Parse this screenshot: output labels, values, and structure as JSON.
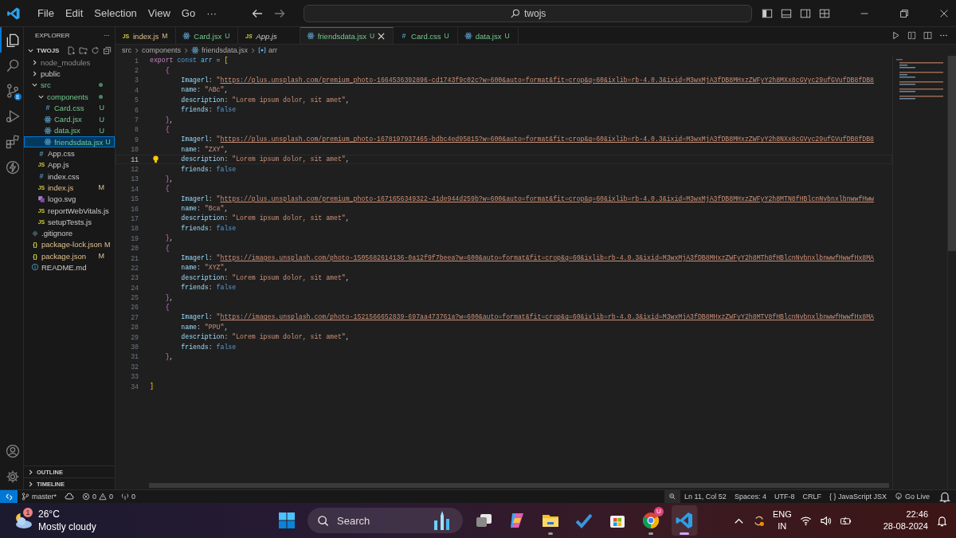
{
  "title_bar": {
    "menus": [
      "File",
      "Edit",
      "Selection",
      "View",
      "Go",
      "···"
    ],
    "command_center": "twojs"
  },
  "activity_bar": {
    "items": [
      {
        "kind": "explorer",
        "selected": true
      },
      {
        "kind": "search",
        "selected": false
      },
      {
        "kind": "source-control",
        "selected": false,
        "badge": "8"
      },
      {
        "kind": "run",
        "selected": false
      },
      {
        "kind": "extensions",
        "selected": false
      },
      {
        "kind": "lightning",
        "selected": false
      }
    ],
    "bottom": [
      {
        "kind": "account"
      },
      {
        "kind": "settings"
      }
    ]
  },
  "sidebar": {
    "title": "EXPLORER",
    "more": "···",
    "folder": {
      "name": "TWOJS",
      "expanded": true,
      "children": [
        {
          "name": "node_modules",
          "kind": "folder",
          "expanded": false,
          "untracked": false,
          "modified": false,
          "ignored": true,
          "selected": false
        },
        {
          "name": "public",
          "kind": "folder",
          "expanded": false,
          "untracked": false,
          "modified": false,
          "ignored": false,
          "selected": false
        },
        {
          "name": "src",
          "kind": "folder",
          "expanded": true,
          "untracked": true,
          "modified": false,
          "ignored": false,
          "selected": false,
          "children": [
            {
              "name": "components",
              "kind": "folder",
              "expanded": true,
              "untracked": true,
              "modified": false,
              "ignored": false,
              "selected": false,
              "children": [
                {
                  "name": "Card.css",
                  "kind": "css",
                  "glyph": "#",
                  "untracked": true,
                  "modified": false,
                  "ignored": false,
                  "badge": "U",
                  "selected": false
                },
                {
                  "name": "Card.jsx",
                  "kind": "react",
                  "untracked": true,
                  "modified": false,
                  "ignored": false,
                  "badge": "U",
                  "selected": false
                },
                {
                  "name": "data.jsx",
                  "kind": "react",
                  "untracked": true,
                  "modified": false,
                  "ignored": false,
                  "badge": "U",
                  "selected": false
                },
                {
                  "name": "friendsdata.jsx",
                  "kind": "react",
                  "untracked": true,
                  "modified": false,
                  "ignored": false,
                  "badge": "U",
                  "selected": true
                }
              ]
            },
            {
              "name": "App.css",
              "kind": "css",
              "glyph": "#",
              "untracked": false,
              "modified": false,
              "ignored": false,
              "selected": false
            },
            {
              "name": "App.js",
              "kind": "js",
              "glyph": "JS",
              "untracked": false,
              "modified": false,
              "ignored": false,
              "selected": false
            },
            {
              "name": "index.css",
              "kind": "css",
              "glyph": "#",
              "untracked": false,
              "modified": false,
              "ignored": false,
              "selected": false
            },
            {
              "name": "index.js",
              "kind": "js",
              "glyph": "JS",
              "untracked": false,
              "modified": true,
              "ignored": false,
              "badge": "M",
              "selected": false
            },
            {
              "name": "logo.svg",
              "kind": "svg",
              "untracked": false,
              "modified": false,
              "ignored": false,
              "selected": false
            },
            {
              "name": "reportWebVitals.js",
              "kind": "js",
              "glyph": "JS",
              "untracked": false,
              "modified": false,
              "ignored": false,
              "selected": false
            },
            {
              "name": "setupTests.js",
              "kind": "js",
              "glyph": "JS",
              "untracked": false,
              "modified": false,
              "ignored": false,
              "selected": false
            }
          ]
        },
        {
          "name": ".gitignore",
          "kind": "git",
          "untracked": false,
          "modified": false,
          "ignored": false,
          "selected": false
        },
        {
          "name": "package-lock.json",
          "kind": "json",
          "glyph": "{}",
          "untracked": false,
          "modified": true,
          "ignored": false,
          "badge": "M",
          "selected": false
        },
        {
          "name": "package.json",
          "kind": "json",
          "glyph": "{}",
          "untracked": false,
          "modified": true,
          "ignored": false,
          "badge": "M",
          "selected": false
        },
        {
          "name": "README.md",
          "kind": "info",
          "untracked": false,
          "modified": false,
          "ignored": false,
          "selected": false
        }
      ]
    },
    "sections": [
      {
        "name": "OUTLINE",
        "expanded": false
      },
      {
        "name": "TIMELINE",
        "expanded": false
      }
    ]
  },
  "tabs": [
    {
      "label": "index.js",
      "kind": "js",
      "glyph": "JS",
      "untracked": false,
      "modified": true,
      "ignored": false,
      "badge": "M",
      "preview": false,
      "selected": false
    },
    {
      "label": "Card.jsx",
      "kind": "react",
      "untracked": true,
      "modified": false,
      "ignored": false,
      "badge": "U",
      "preview": false,
      "selected": false
    },
    {
      "label": "App.js",
      "kind": "js",
      "glyph": "JS",
      "untracked": false,
      "modified": false,
      "ignored": false,
      "preview": true,
      "selected": false
    },
    {
      "label": "friendsdata.jsx",
      "kind": "react",
      "untracked": true,
      "modified": false,
      "ignored": false,
      "badge": "U",
      "preview": false,
      "selected": true
    },
    {
      "label": "Card.css",
      "kind": "css",
      "glyph": "#",
      "untracked": true,
      "modified": false,
      "ignored": false,
      "badge": "U",
      "preview": false,
      "selected": false
    },
    {
      "label": "data.jsx",
      "kind": "react",
      "untracked": true,
      "modified": false,
      "ignored": false,
      "badge": "U",
      "preview": false,
      "selected": false
    }
  ],
  "breadcrumb": [
    {
      "label": "src",
      "kind": "folder"
    },
    {
      "label": "components",
      "kind": "folder"
    },
    {
      "label": "friendsdata.jsx",
      "kind": "react"
    },
    {
      "label": "arr",
      "kind": "symbol"
    }
  ],
  "code": [
    {
      "number": "1",
      "kind": "top",
      "current": false,
      "tokens": [
        {
          "kind": "kw2",
          "text": "export"
        },
        {
          "kind": "kw",
          "text": " const"
        },
        {
          "kind": "var",
          "text": " arr"
        },
        {
          "kind": "op",
          "text": " = "
        },
        {
          "kind": "br1",
          "text": "["
        }
      ]
    },
    {
      "number": "2",
      "kind": "object",
      "current": false,
      "tokens": [
        {
          "kind": "br2",
          "text": "{"
        }
      ]
    },
    {
      "number": "3",
      "kind": "field",
      "current": false,
      "tokens": [
        {
          "kind": "prop",
          "text": "Imagerl"
        },
        {
          "kind": "op",
          "text": ": "
        },
        {
          "kind": "str",
          "text": "\""
        },
        {
          "kind": "url",
          "text": "https://plus.unsplash.com/premium_photo-1664536392896-cd1743f9c02c?w=600&auto=format&fit=crop&q=60&ixlib=rb-4.0.3&ixid=M3wxMjA3fDB8MHxzZWFyY2h8MXx8cGVyc29ufGVufDB8fDB8"
        }
      ]
    },
    {
      "number": "4",
      "kind": "field",
      "current": false,
      "tokens": [
        {
          "kind": "prop",
          "text": "name"
        },
        {
          "kind": "op",
          "text": ": "
        },
        {
          "kind": "str",
          "text": "\"ABc\""
        },
        {
          "kind": "op",
          "text": ","
        }
      ]
    },
    {
      "number": "5",
      "kind": "field",
      "current": false,
      "tokens": [
        {
          "kind": "prop",
          "text": "description"
        },
        {
          "kind": "op",
          "text": ": "
        },
        {
          "kind": "str",
          "text": "\"Lorem ipsum dolor, sit amet\""
        },
        {
          "kind": "op",
          "text": ","
        }
      ]
    },
    {
      "number": "6",
      "kind": "field",
      "current": false,
      "tokens": [
        {
          "kind": "prop",
          "text": "friends"
        },
        {
          "kind": "op",
          "text": ": "
        },
        {
          "kind": "bool",
          "text": "false"
        }
      ]
    },
    {
      "number": "7",
      "kind": "object",
      "current": false,
      "tokens": [
        {
          "kind": "br2",
          "text": "}"
        },
        {
          "kind": "op",
          "text": ","
        }
      ]
    },
    {
      "number": "8",
      "kind": "object",
      "current": false,
      "tokens": [
        {
          "kind": "br2",
          "text": "{"
        }
      ]
    },
    {
      "number": "9",
      "kind": "field",
      "current": false,
      "tokens": [
        {
          "kind": "prop",
          "text": "Imagerl"
        },
        {
          "kind": "op",
          "text": ": "
        },
        {
          "kind": "str",
          "text": "\""
        },
        {
          "kind": "url",
          "text": "https://plus.unsplash.com/premium_photo-1678197937465-bdbc4ed95815?w=600&auto=format&fit=crop&q=60&ixlib=rb-4.0.3&ixid=M3wxMjA3fDB8MHxzZWFyY2h8NXx8cGVyc29ufGVufDB8fDB8"
        }
      ]
    },
    {
      "number": "10",
      "kind": "field",
      "current": false,
      "tokens": [
        {
          "kind": "prop",
          "text": "name"
        },
        {
          "kind": "op",
          "text": ": "
        },
        {
          "kind": "str",
          "text": "\"ZXY\""
        },
        {
          "kind": "op",
          "text": ","
        }
      ]
    },
    {
      "number": "11",
      "kind": "field",
      "current": true,
      "tokens": [
        {
          "kind": "prop",
          "text": "description"
        },
        {
          "kind": "op",
          "text": ": "
        },
        {
          "kind": "str",
          "text": "\"Lorem ipsum dolor, sit amet\""
        },
        {
          "kind": "op",
          "text": ","
        }
      ]
    },
    {
      "number": "12",
      "kind": "field",
      "current": false,
      "tokens": [
        {
          "kind": "prop",
          "text": "friends"
        },
        {
          "kind": "op",
          "text": ": "
        },
        {
          "kind": "bool",
          "text": "false"
        }
      ]
    },
    {
      "number": "13",
      "kind": "object",
      "current": false,
      "tokens": [
        {
          "kind": "br2",
          "text": "}"
        },
        {
          "kind": "op",
          "text": ","
        }
      ]
    },
    {
      "number": "14",
      "kind": "object",
      "current": false,
      "tokens": [
        {
          "kind": "br2",
          "text": "{"
        }
      ]
    },
    {
      "number": "15",
      "kind": "field",
      "current": false,
      "tokens": [
        {
          "kind": "prop",
          "text": "Imagerl"
        },
        {
          "kind": "op",
          "text": ": "
        },
        {
          "kind": "str",
          "text": "\""
        },
        {
          "kind": "url",
          "text": "https://plus.unsplash.com/premium_photo-1671656349322-41de944d259b?w=600&auto=format&fit=crop&q=60&ixlib=rb-4.0.3&ixid=M3wxMjA3fDB8MHxzZWFyY2h8MTN8fHBlcnNvbnxlbnwwfHww"
        }
      ]
    },
    {
      "number": "16",
      "kind": "field",
      "current": false,
      "tokens": [
        {
          "kind": "prop",
          "text": "name"
        },
        {
          "kind": "op",
          "text": ": "
        },
        {
          "kind": "str",
          "text": "\"Bca\""
        },
        {
          "kind": "op",
          "text": ","
        }
      ]
    },
    {
      "number": "17",
      "kind": "field",
      "current": false,
      "tokens": [
        {
          "kind": "prop",
          "text": "description"
        },
        {
          "kind": "op",
          "text": ": "
        },
        {
          "kind": "str",
          "text": "\"Lorem ipsum dolor, sit amet\""
        },
        {
          "kind": "op",
          "text": ","
        }
      ]
    },
    {
      "number": "18",
      "kind": "field",
      "current": false,
      "tokens": [
        {
          "kind": "prop",
          "text": "friends"
        },
        {
          "kind": "op",
          "text": ": "
        },
        {
          "kind": "bool",
          "text": "false"
        }
      ]
    },
    {
      "number": "19",
      "kind": "object",
      "current": false,
      "tokens": [
        {
          "kind": "br2",
          "text": "}"
        },
        {
          "kind": "op",
          "text": ","
        }
      ]
    },
    {
      "number": "20",
      "kind": "object",
      "current": false,
      "tokens": [
        {
          "kind": "br2",
          "text": "{"
        }
      ]
    },
    {
      "number": "21",
      "kind": "field",
      "current": false,
      "tokens": [
        {
          "kind": "prop",
          "text": "Imagerl"
        },
        {
          "kind": "op",
          "text": ": "
        },
        {
          "kind": "str",
          "text": "\""
        },
        {
          "kind": "url",
          "text": "https://images.unsplash.com/photo-1505682614136-0a12f9f7beea?w=600&auto=format&fit=crop&q=60&ixlib=rb-4.0.3&ixid=M3wxMjA3fDB8MHxzZWFyY2h8MTh8fHBlcnNvbnxlbnwwfHwwfHx8MA"
        }
      ]
    },
    {
      "number": "22",
      "kind": "field",
      "current": false,
      "tokens": [
        {
          "kind": "prop",
          "text": "name"
        },
        {
          "kind": "op",
          "text": ": "
        },
        {
          "kind": "str",
          "text": "\"XYZ\""
        },
        {
          "kind": "op",
          "text": ","
        }
      ]
    },
    {
      "number": "23",
      "kind": "field",
      "current": false,
      "tokens": [
        {
          "kind": "prop",
          "text": "description"
        },
        {
          "kind": "op",
          "text": ": "
        },
        {
          "kind": "str",
          "text": "\"Lorem ipsum dolor, sit amet\""
        },
        {
          "kind": "op",
          "text": ","
        }
      ]
    },
    {
      "number": "24",
      "kind": "field",
      "current": false,
      "tokens": [
        {
          "kind": "prop",
          "text": "friends"
        },
        {
          "kind": "op",
          "text": ": "
        },
        {
          "kind": "bool",
          "text": "false"
        }
      ]
    },
    {
      "number": "25",
      "kind": "object",
      "current": false,
      "tokens": [
        {
          "kind": "br2",
          "text": "}"
        },
        {
          "kind": "op",
          "text": ","
        }
      ]
    },
    {
      "number": "26",
      "kind": "object",
      "current": false,
      "tokens": [
        {
          "kind": "br2",
          "text": "{"
        }
      ]
    },
    {
      "number": "27",
      "kind": "field",
      "current": false,
      "tokens": [
        {
          "kind": "prop",
          "text": "Imagerl"
        },
        {
          "kind": "op",
          "text": ": "
        },
        {
          "kind": "str",
          "text": "\""
        },
        {
          "kind": "url",
          "text": "https://images.unsplash.com/photo-1521566652839-697aa473761a?w=600&auto=format&fit=crop&q=60&ixlib=rb-4.0.3&ixid=M3wxMjA3fDB8MHxzZWFyY2h8MTV8fHBlcnNvbnxlbnwwfHwwfHx8MA"
        }
      ]
    },
    {
      "number": "28",
      "kind": "field",
      "current": false,
      "tokens": [
        {
          "kind": "prop",
          "text": "name"
        },
        {
          "kind": "op",
          "text": ": "
        },
        {
          "kind": "str",
          "text": "\"PPU\""
        },
        {
          "kind": "op",
          "text": ","
        }
      ]
    },
    {
      "number": "29",
      "kind": "field",
      "current": false,
      "tokens": [
        {
          "kind": "prop",
          "text": "description"
        },
        {
          "kind": "op",
          "text": ": "
        },
        {
          "kind": "str",
          "text": "\"Lorem ipsum dolor, sit amet\""
        },
        {
          "kind": "op",
          "text": ","
        }
      ]
    },
    {
      "number": "30",
      "kind": "field",
      "current": false,
      "tokens": [
        {
          "kind": "prop",
          "text": "friends"
        },
        {
          "kind": "op",
          "text": ": "
        },
        {
          "kind": "bool",
          "text": "false"
        }
      ]
    },
    {
      "number": "31",
      "kind": "object",
      "current": false,
      "tokens": [
        {
          "kind": "br2",
          "text": "}"
        },
        {
          "kind": "op",
          "text": ","
        }
      ]
    },
    {
      "number": "32",
      "kind": "blank",
      "current": false
    },
    {
      "number": "33",
      "kind": "blank",
      "current": false
    },
    {
      "number": "34",
      "kind": "top",
      "current": false,
      "tokens": [
        {
          "kind": "br1",
          "text": "]"
        }
      ]
    }
  ],
  "status_bar": {
    "branch": "master*",
    "errors": "0",
    "warnings": "0",
    "ports": "0",
    "right": [
      "Ln 11, Col 52",
      "Spaces: 4",
      "UTF-8",
      "CRLF",
      "{ } JavaScript JSX",
      "Go Live"
    ]
  },
  "taskbar": {
    "weather": {
      "temperature": "26°C",
      "condition": "Mostly cloudy",
      "badge": "1"
    },
    "search": "Search",
    "apps": [
      {
        "kind": "start",
        "running": false,
        "active": false
      },
      {
        "kind": "search"
      },
      {
        "kind": "task-view",
        "running": false,
        "active": false
      },
      {
        "kind": "copilot",
        "running": false,
        "active": false
      },
      {
        "kind": "files",
        "running": true,
        "active": false
      },
      {
        "kind": "todo",
        "running": false,
        "active": false
      },
      {
        "kind": "store",
        "running": false,
        "active": false
      },
      {
        "kind": "chrome",
        "running": true,
        "active": false,
        "badge": "U"
      },
      {
        "kind": "vscode",
        "running": true,
        "active": true
      }
    ],
    "language": "ENG",
    "region": "IN",
    "time": "22:46",
    "date": "28-08-2024"
  }
}
